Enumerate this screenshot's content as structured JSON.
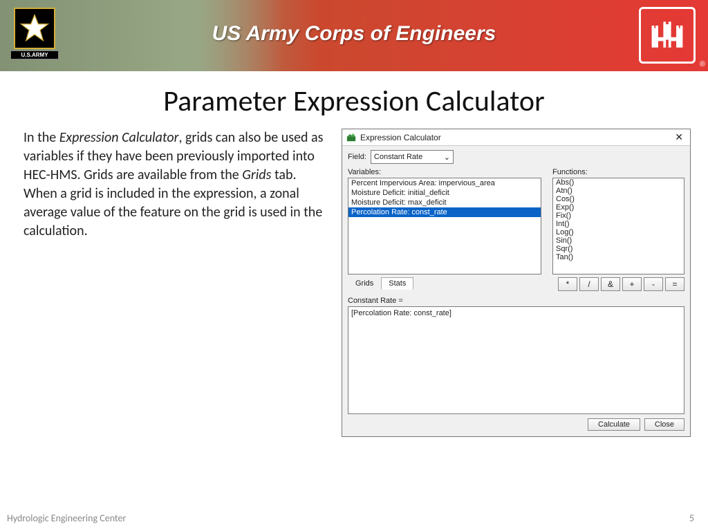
{
  "banner": {
    "title": "US Army Corps of Engineers",
    "army_label": "U.S.ARMY"
  },
  "slide": {
    "title": "Parameter Expression Calculator",
    "body_pre": "In the ",
    "body_em1": "Expression Calculator",
    "body_mid": ", grids can also be used as variables if they have been previously imported into HEC-HMS. Grids are available from the ",
    "body_em2": "Grids",
    "body_post": " tab. When a grid is included in the expression, a zonal average value of the feature on the grid is used in the calculation."
  },
  "dialog": {
    "title": "Expression Calculator",
    "field_label": "Field:",
    "field_value": "Constant Rate",
    "variables_label": "Variables:",
    "variables": [
      "Percent Impervious Area: impervious_area",
      "Moisture Deficit: initial_deficit",
      "Moisture Deficit: max_deficit",
      "Percolation Rate: const_rate"
    ],
    "functions_label": "Functions:",
    "functions": [
      "Abs()",
      "Atn()",
      "Cos()",
      "Exp()",
      "Fix()",
      "Int()",
      "Log()",
      "Sin()",
      "Sqr()",
      "Tan()"
    ],
    "tabs": {
      "grids": "Grids",
      "stats": "Stats"
    },
    "ops": [
      "*",
      "/",
      "&",
      "+",
      "-",
      "="
    ],
    "expr_label": "Constant Rate =",
    "expr_value": "[Percolation Rate: const_rate]",
    "calculate": "Calculate",
    "close": "Close"
  },
  "footer": {
    "left": "Hydrologic Engineering Center",
    "right": "5"
  }
}
